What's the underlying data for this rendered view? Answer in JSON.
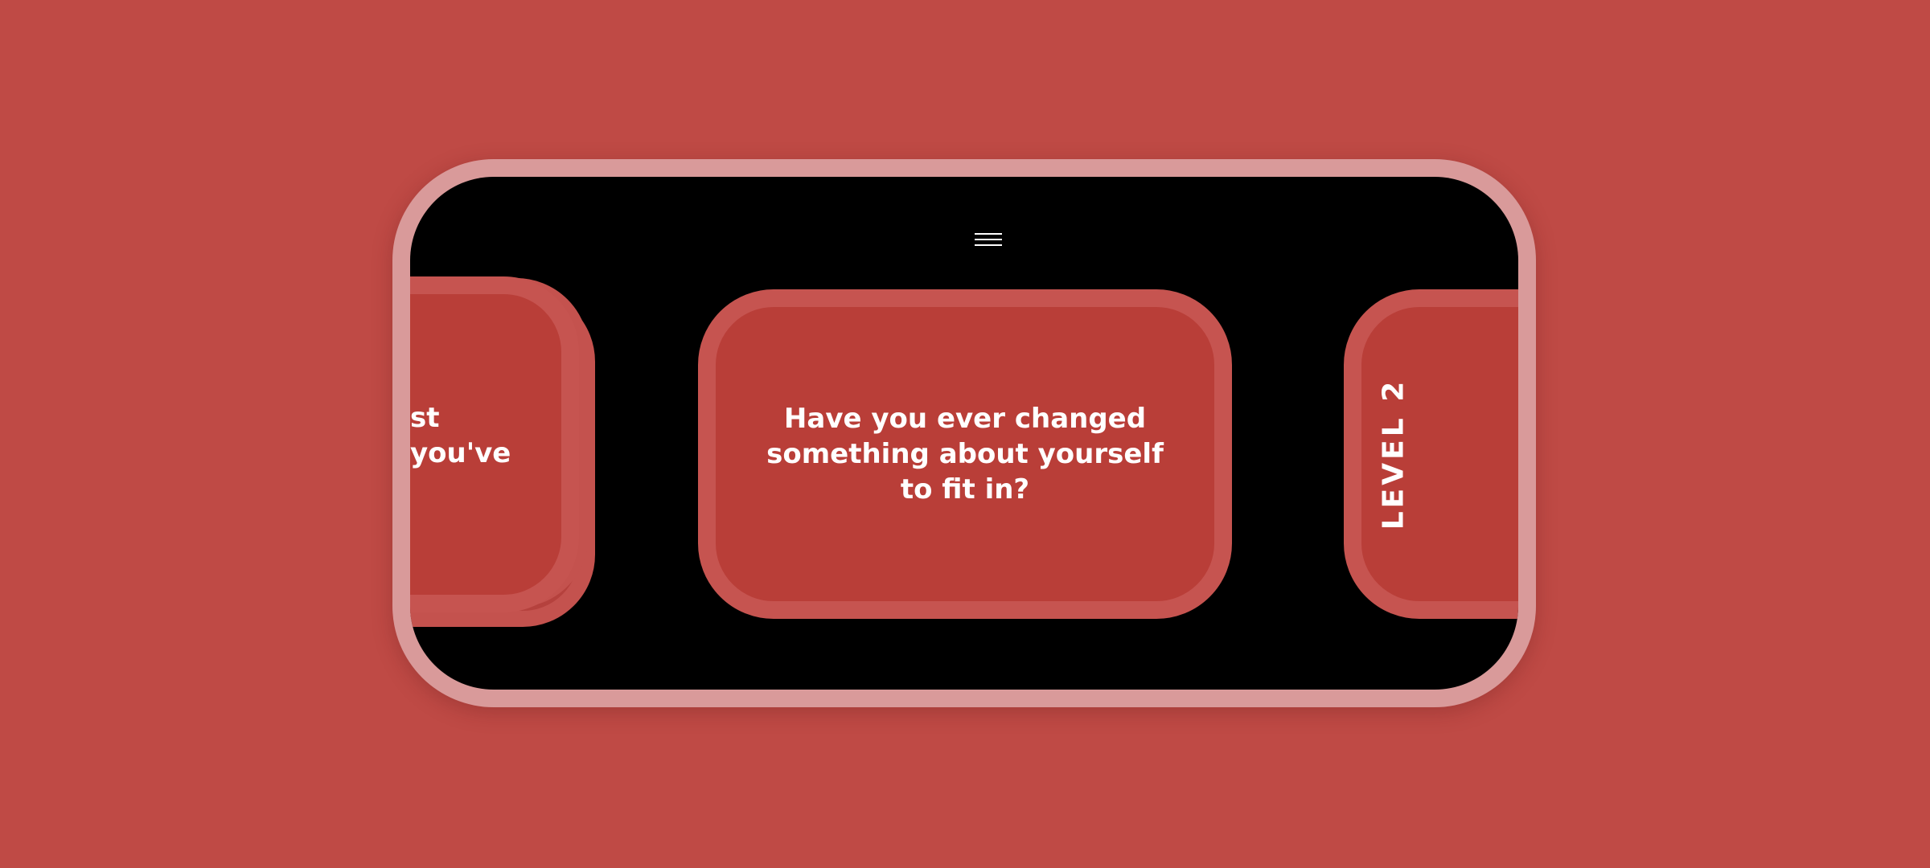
{
  "menu": {
    "icon": "hamburger-menu-icon"
  },
  "cards": {
    "previous": {
      "text_line1": "st",
      "text_line2": "you've"
    },
    "current": {
      "question": "Have you ever changed something about yourself to fit in?"
    },
    "next": {
      "label": "LEVEL 2"
    }
  },
  "colors": {
    "background": "#bf4a45",
    "device_frame": "#d99a9a",
    "screen": "#000000",
    "card_fill": "#b93e38",
    "card_border": "#c65450",
    "text": "#ffffff"
  }
}
